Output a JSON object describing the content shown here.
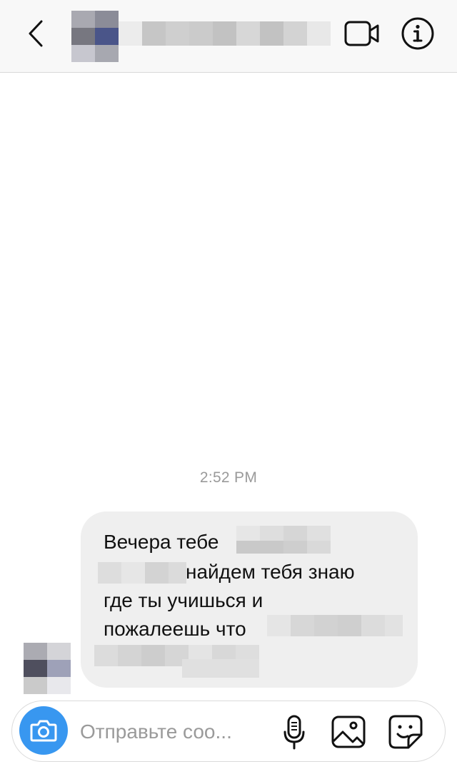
{
  "header": {
    "back_icon": "chevron-left-icon",
    "video_icon": "video-camera-icon",
    "info_icon": "info-icon"
  },
  "conversation": {
    "timestamp": "2:52 PM",
    "message": {
      "line1": "Вечера тебе",
      "line2": "найдем тебя знаю",
      "line3": "где ты учишься и",
      "line4": "пожалеешь что"
    }
  },
  "composer": {
    "placeholder": "Отправьте соо...",
    "camera_icon": "camera-icon",
    "mic_icon": "microphone-icon",
    "gallery_icon": "gallery-icon",
    "sticker_icon": "sticker-icon",
    "accent_color": "#3897f0"
  }
}
